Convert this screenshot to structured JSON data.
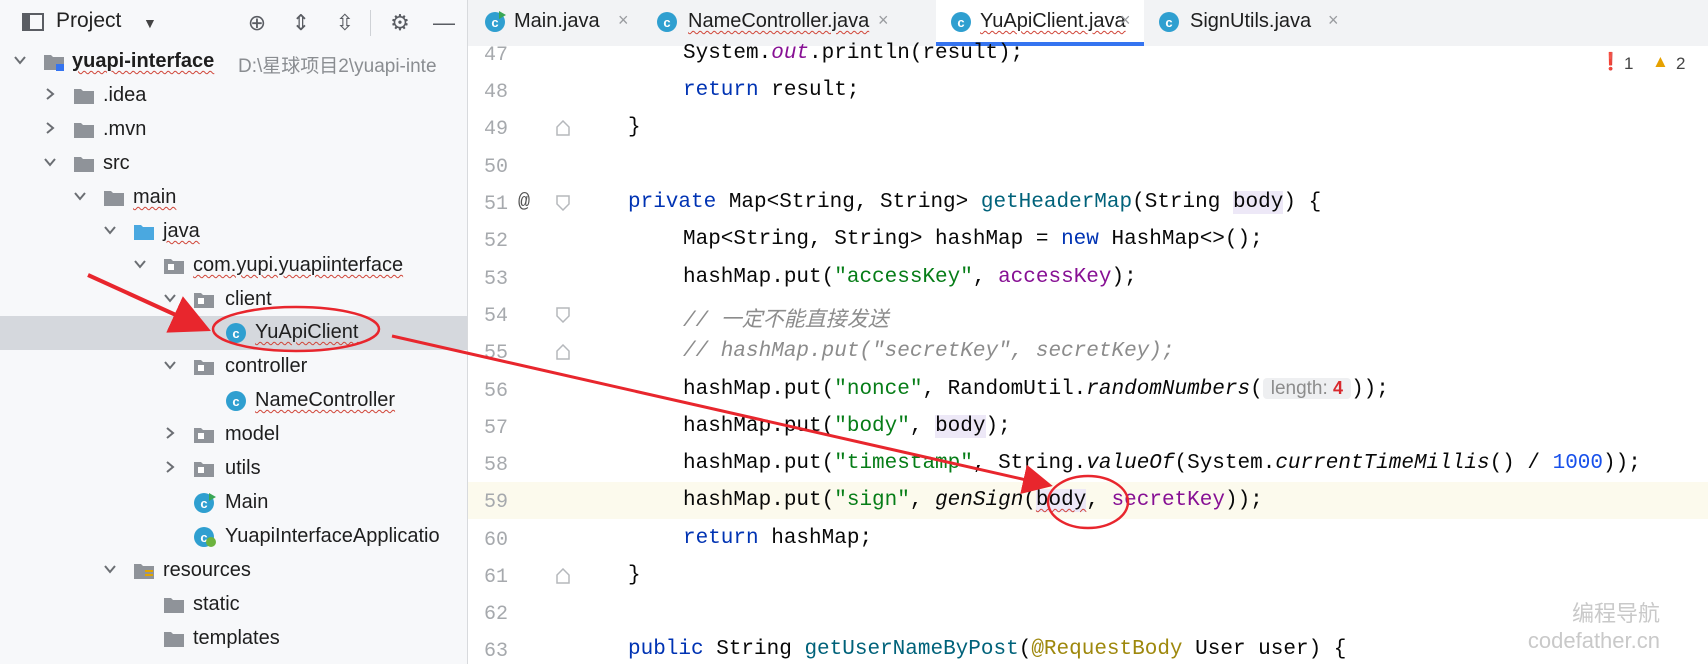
{
  "project_panel": {
    "title": "Project",
    "toolbar_icons": [
      "locate-icon",
      "expand-all-icon",
      "collapse-all-icon",
      "gear-icon",
      "minimize-icon"
    ],
    "tree": [
      {
        "label": "yuapi-interface",
        "path": "D:\\星球项目2\\yuapi-inte"
      },
      {
        "label": ".idea"
      },
      {
        "label": ".mvn"
      },
      {
        "label": "src"
      },
      {
        "label": "main"
      },
      {
        "label": "java"
      },
      {
        "label": "com.yupi.yuapiinterface"
      },
      {
        "label": "client"
      },
      {
        "label": "YuApiClient"
      },
      {
        "label": "controller"
      },
      {
        "label": "NameController"
      },
      {
        "label": "model"
      },
      {
        "label": "utils"
      },
      {
        "label": "Main"
      },
      {
        "label": "YuapiInterfaceApplicatio"
      },
      {
        "label": "resources"
      },
      {
        "label": "static"
      },
      {
        "label": "templates"
      }
    ]
  },
  "editor": {
    "tabs": [
      {
        "label": "Main.java"
      },
      {
        "label": "NameController.java"
      },
      {
        "label": "YuApiClient.java"
      },
      {
        "label": "SignUtils.java"
      }
    ],
    "close_glyph": "×",
    "inspections": {
      "errors": "1",
      "warnings": "2"
    },
    "hint": {
      "name": "length:",
      "value": "4"
    },
    "line_numbers": [
      "47",
      "48",
      "49",
      "50",
      "51",
      "52",
      "53",
      "54",
      "55",
      "56",
      "57",
      "58",
      "59",
      "60",
      "61",
      "62",
      "63"
    ],
    "gutter_at": "@",
    "code": {
      "l47": {
        "a": "System.",
        "b": "out",
        "c": ".println(result);"
      },
      "l48": {
        "a": "return",
        "b": " result;"
      },
      "l49": "}",
      "l51": {
        "a": "private",
        "b": " Map<String, String> ",
        "c": "getHeaderMap",
        "d": "(String ",
        "e": "body",
        "f": ") {"
      },
      "l52": {
        "a": "Map<String, String> hashMap = ",
        "b": "new",
        "c": " HashMap<>();"
      },
      "l53": {
        "a": "hashMap.put(",
        "b": "\"accessKey\"",
        "c": ", ",
        "d": "accessKey",
        "e": ");"
      },
      "l54": "// 一定不能直接发送",
      "l55": "// hashMap.put(\"secretKey\", secretKey);",
      "l56": {
        "a": "hashMap.put(",
        "b": "\"nonce\"",
        "c": ", RandomUtil.",
        "d": "randomNumbers",
        "e": "(",
        "f": "));"
      },
      "l57": {
        "a": "hashMap.put(",
        "b": "\"body\"",
        "c": ", ",
        "d": "body",
        "e": ");"
      },
      "l58": {
        "a": "hashMap.put(",
        "b": "\"timestamp\"",
        "c": ", String.",
        "d": "valueOf",
        "e": "(System.",
        "f": "currentTimeMillis",
        "g": "() / ",
        "h": "1000",
        "i": "));"
      },
      "l59": {
        "a": "hashMap.put(",
        "b": "\"sign\"",
        "c": ", ",
        "d": "genSign",
        "e": "(",
        "f": "body",
        "g": ", ",
        "h": "secretKey",
        "i": "));"
      },
      "l60": {
        "a": "return",
        "b": " hashMap;"
      },
      "l61": "}",
      "l63": {
        "a": "public",
        "b": " String ",
        "c": "getUserNameByPost",
        "d": "(",
        "e": "@RequestBody",
        "f": " User user) {"
      }
    }
  },
  "watermark": {
    "line1": "编程导航",
    "line2": "codefather.cn"
  },
  "colors": {
    "annotation_red": "#e8262d",
    "accent": "#3574f0"
  }
}
